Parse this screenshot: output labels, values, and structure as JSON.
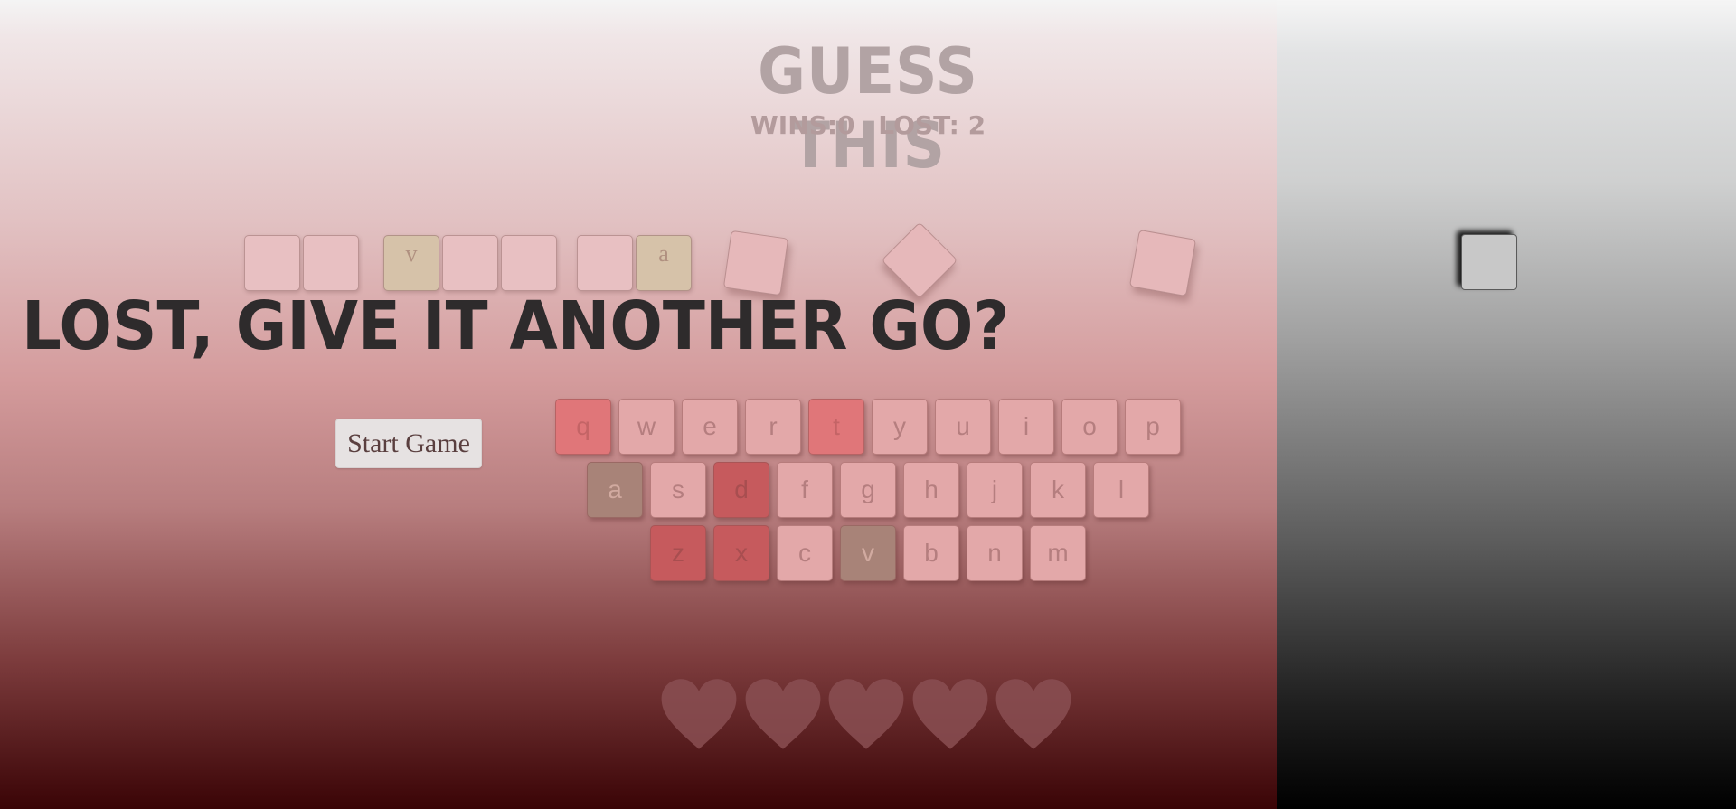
{
  "header": {
    "title": "GUESS THIS",
    "wins_label": "WINS:0",
    "lost_label": "LOST: 2"
  },
  "word": {
    "groups": [
      [
        "",
        ""
      ],
      [
        "v",
        "",
        ""
      ],
      [
        "",
        "a"
      ]
    ]
  },
  "message": "LOST, GIVE IT ANOTHER GO?",
  "start_button": "Start Game",
  "keyboard": {
    "rows": [
      [
        "q",
        "w",
        "e",
        "r",
        "t",
        "y",
        "u",
        "i",
        "o",
        "p"
      ],
      [
        "a",
        "s",
        "d",
        "f",
        "g",
        "h",
        "j",
        "k",
        "l"
      ],
      [
        "z",
        "x",
        "c",
        "v",
        "b",
        "n",
        "m"
      ]
    ],
    "wrong": [
      "q",
      "t",
      "d",
      "z",
      "x"
    ],
    "correct": [
      "a",
      "v"
    ]
  },
  "lives": {
    "remaining": 5,
    "icon": "heart-icon"
  },
  "colors": {
    "key": "#e3a8a9",
    "key_wrong": "#e07679",
    "key_correct": "#a88378",
    "tile_found": "#d6c2a9",
    "heart": "#8a4f52"
  }
}
